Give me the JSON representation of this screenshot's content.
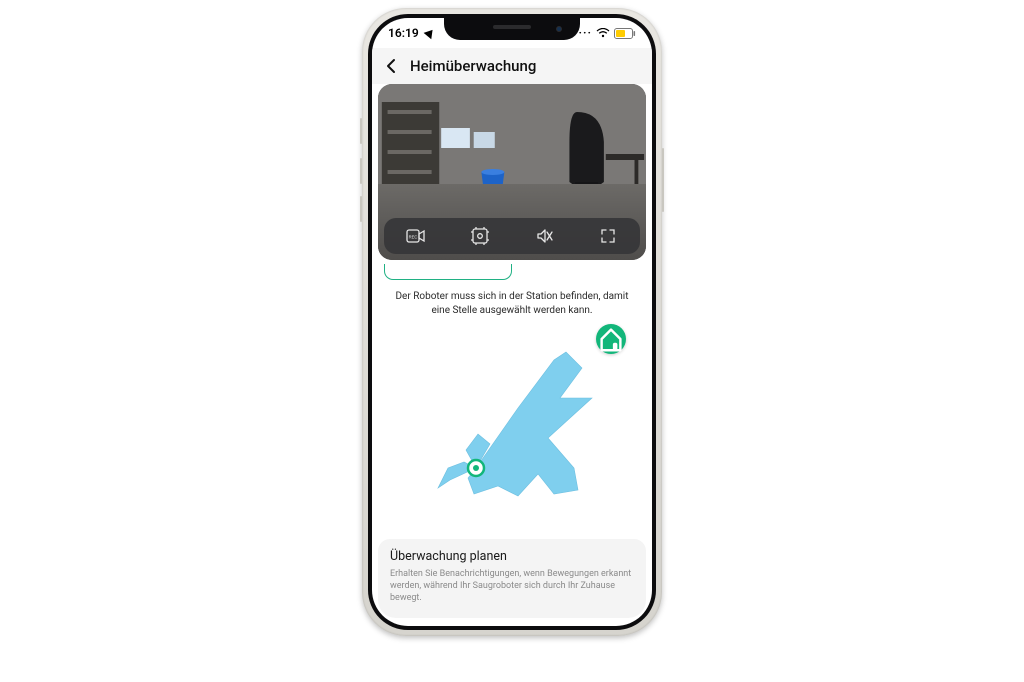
{
  "status_bar": {
    "time": "16:19",
    "location_active": true,
    "wifi_dots": "···",
    "battery_color": "#ffcc00"
  },
  "header": {
    "title": "Heimüberwachung"
  },
  "camera_toolbar": {
    "record_label": "REC",
    "items": [
      "record-icon",
      "snapshot-icon",
      "mute-icon",
      "fullscreen-icon"
    ]
  },
  "map": {
    "hint": "Der Roboter muss sich in der Station befinden, damit eine Stelle ausgewählt werden kann.",
    "dock_icon": "home-dock-icon",
    "scan_color": "#7fcfee",
    "robot_color": "#12b67a"
  },
  "plan_card": {
    "title": "Überwachung planen",
    "description": "Erhalten Sie Benachrichtigungen, wenn Bewegungen erkannt werden, während Ihr Saugroboter sich durch Ihr Zuhause bewegt."
  }
}
